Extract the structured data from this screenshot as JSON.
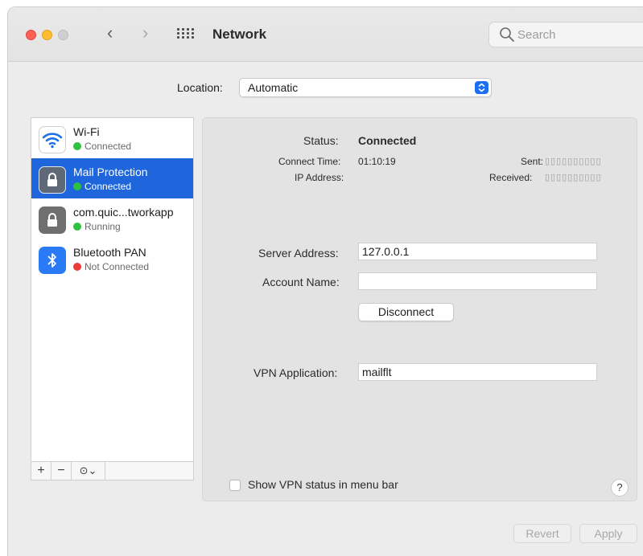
{
  "window": {
    "title": "Network",
    "search_placeholder": "Search",
    "back_glyph": "‹",
    "forward_glyph": "›"
  },
  "location": {
    "label": "Location:",
    "value": "Automatic"
  },
  "services": [
    {
      "name": "Wi-Fi",
      "status": "Connected",
      "status_color": "#2fc140",
      "icon": "wifi-icon",
      "selected": false
    },
    {
      "name": "Mail Protection",
      "status": "Connected",
      "status_color": "#2fc140",
      "icon": "lock-icon",
      "selected": true
    },
    {
      "name": "com.quic...tworkapp",
      "status": "Running",
      "status_color": "#2fc140",
      "icon": "lock-icon",
      "selected": false
    },
    {
      "name": "Bluetooth PAN",
      "status": "Not Connected",
      "status_color": "#ea3a3a",
      "icon": "bluetooth-icon",
      "selected": false
    }
  ],
  "sidebar_tools": {
    "add": "+",
    "remove": "−",
    "action": "⊙⌄"
  },
  "detail": {
    "status_label": "Status:",
    "status_value": "Connected",
    "connect_time_label": "Connect Time:",
    "connect_time_value": "01:10:19",
    "ip_label": "IP Address:",
    "sent_label": "Sent:",
    "sent_value": "▯▯▯▯▯▯▯▯▯▯",
    "received_label": "Received:",
    "received_value": "▯▯▯▯▯▯▯▯▯▯",
    "server_address_label": "Server Address:",
    "server_address_value": "127.0.0.1",
    "account_name_label": "Account Name:",
    "account_name_value": "",
    "disconnect_label": "Disconnect",
    "vpn_app_label": "VPN Application:",
    "vpn_app_value": "mailflt",
    "show_vpn_status_label": "Show VPN status in menu bar",
    "help_label": "?"
  },
  "footer": {
    "revert_label": "Revert",
    "apply_label": "Apply"
  },
  "colors": {
    "accent": "#1f66dc",
    "connected": "#2fc140",
    "not_connected": "#ea3a3a"
  }
}
